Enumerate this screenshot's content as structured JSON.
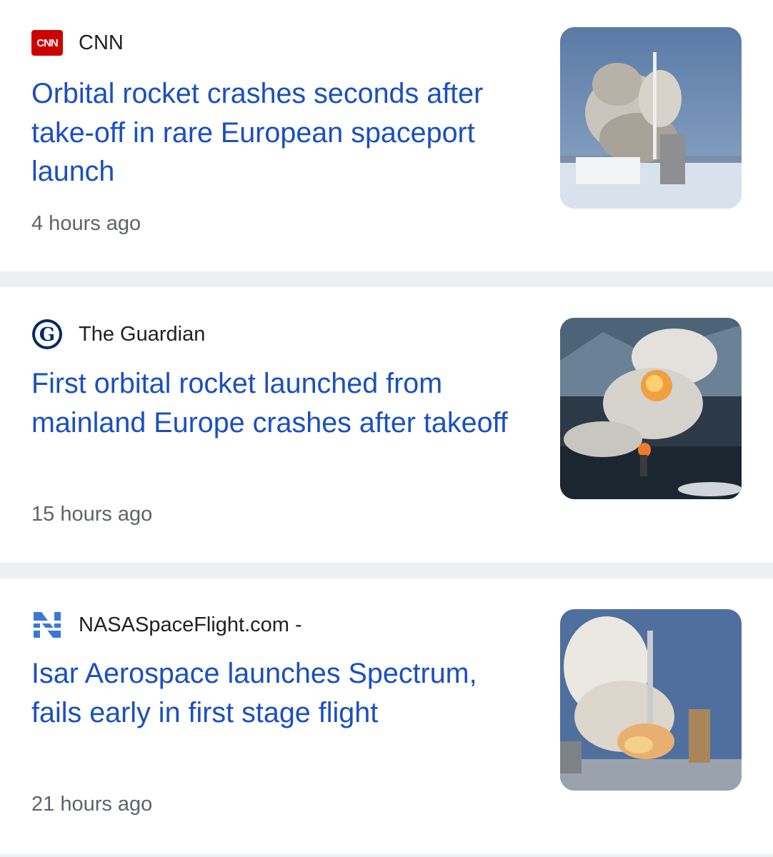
{
  "articles": [
    {
      "source": "CNN",
      "source_icon": "cnn-logo-icon",
      "headline": "Orbital rocket crashes seconds after take-off in rare European spaceport launch",
      "time": "4 hours ago",
      "thumbnail": "rocket-launch-smoke-image"
    },
    {
      "source": "The Guardian",
      "source_icon": "guardian-logo-icon",
      "headline": "First orbital rocket launched from mainland Europe crashes after takeoff",
      "time": "15 hours ago",
      "thumbnail": "rocket-explosion-image"
    },
    {
      "source": "NASASpaceFlight.com -",
      "source_icon": "nasaspaceflight-logo-icon",
      "headline": "Isar Aerospace launches Spectrum, fails early in first stage flight",
      "time": "21 hours ago",
      "thumbnail": "rocket-pad-fire-image"
    }
  ],
  "colors": {
    "headline": "#1a4fc0",
    "source": "#202124",
    "time": "#5f6368",
    "divider": "#eeeff1",
    "cnn_red": "#cc0000",
    "guardian_navy": "#052962",
    "nsf_blue": "#3a78d8"
  },
  "logo_text": {
    "cnn": "CNN"
  }
}
